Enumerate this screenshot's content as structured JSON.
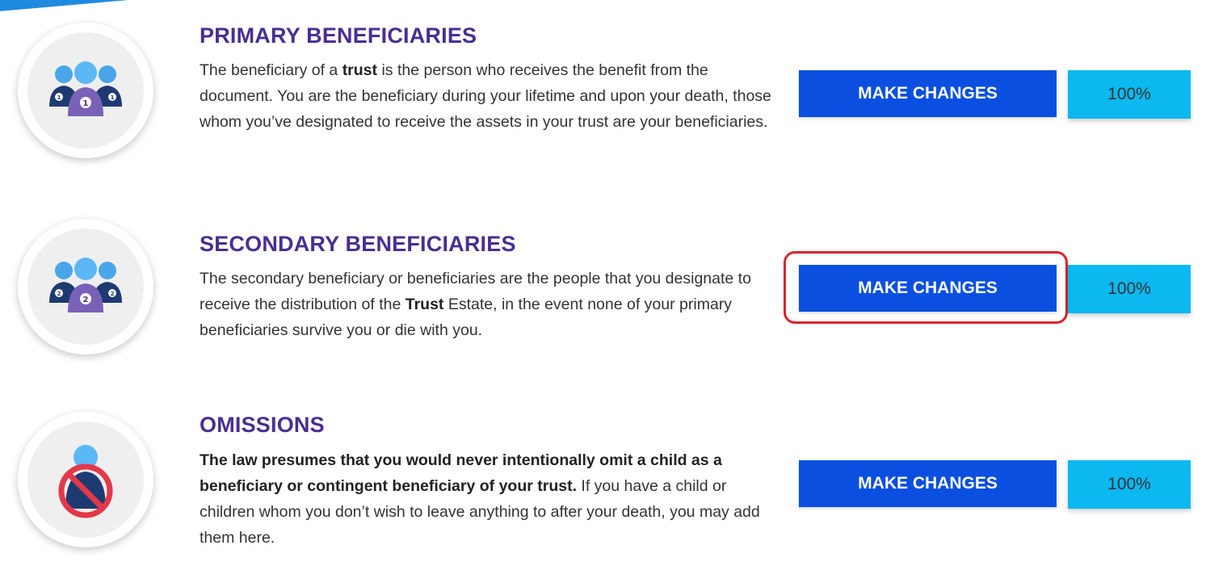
{
  "sections": [
    {
      "title": "PRIMARY BENEFICIARIES",
      "desc_parts": [
        "The beneficiary of a ",
        "trust",
        " is the person who receives the benefit from the document. You are the beneficiary during your lifetime and upon your death, those whom you’ve designated to receive the assets in your trust are your beneficiaries."
      ],
      "badge": "1",
      "button_label": "MAKE CHANGES",
      "percent": "100%",
      "icon": "group-people-icon"
    },
    {
      "title": "SECONDARY BENEFICIARIES",
      "desc_parts": [
        "The secondary beneficiary or beneficiaries are the people that you designate to receive the distribution of the ",
        "Trust",
        " Estate, in the event none of your primary beneficiaries survive you or die with you."
      ],
      "badge": "2",
      "button_label": "MAKE CHANGES",
      "percent": "100%",
      "icon": "group-people-icon"
    },
    {
      "title": "OMISSIONS",
      "desc_parts": [
        "The law presumes that you would never intentionally omit a child as a beneficiary or contingent beneficiary of your trust.",
        " If you have a child or children whom you don’t wish to leave anything to after your death, you may add them here."
      ],
      "button_label": "MAKE CHANGES",
      "percent": "100%",
      "icon": "no-person-icon"
    }
  ],
  "colors": {
    "title": "#4a2e91",
    "button": "#0a4fe0",
    "percent_box": "#0bb8f0",
    "highlight": "#d9252d"
  }
}
